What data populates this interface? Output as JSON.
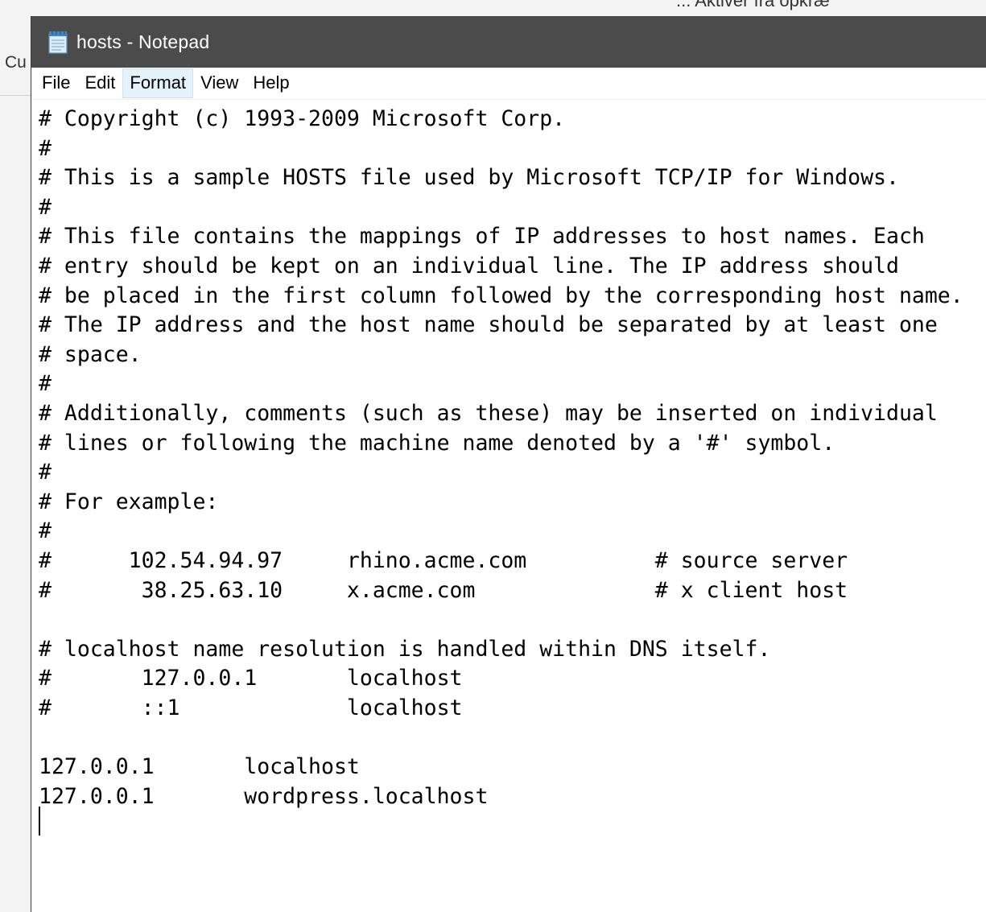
{
  "background": {
    "top_text": "... Aktivér fra opkræ",
    "side_text": "Cu"
  },
  "window": {
    "title": "hosts - Notepad",
    "icon": "notepad-icon",
    "colors": {
      "titlebar": "#4b4b4b",
      "menu_active": "#e5f1fb"
    }
  },
  "menu": {
    "items": [
      {
        "label": "File"
      },
      {
        "label": "Edit"
      },
      {
        "label": "Format",
        "active": true
      },
      {
        "label": "View"
      },
      {
        "label": "Help"
      }
    ]
  },
  "editor": {
    "lines": [
      "# Copyright (c) 1993-2009 Microsoft Corp.",
      "#",
      "# This is a sample HOSTS file used by Microsoft TCP/IP for Windows.",
      "#",
      "# This file contains the mappings of IP addresses to host names. Each",
      "# entry should be kept on an individual line. The IP address should",
      "# be placed in the first column followed by the corresponding host name.",
      "# The IP address and the host name should be separated by at least one",
      "# space.",
      "#",
      "# Additionally, comments (such as these) may be inserted on individual",
      "# lines or following the machine name denoted by a '#' symbol.",
      "#",
      "# For example:",
      "#",
      "#      102.54.94.97     rhino.acme.com          # source server",
      "#       38.25.63.10     x.acme.com              # x client host",
      "",
      "# localhost name resolution is handled within DNS itself.",
      "#       127.0.0.1       localhost",
      "#       ::1             localhost",
      "",
      "127.0.0.1       localhost",
      "127.0.0.1       wordpress.localhost",
      ""
    ]
  }
}
